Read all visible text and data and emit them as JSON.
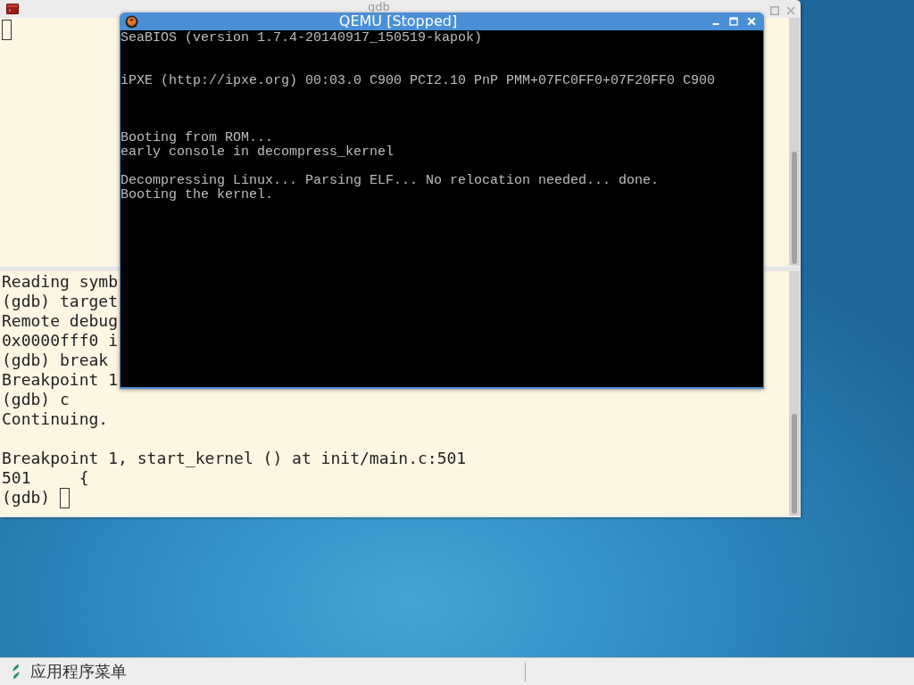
{
  "gdb_window": {
    "title": "gdb",
    "upper_pane": {
      "cursor": true
    },
    "lower_pane": {
      "groups": [
        {
          "lines": [
            "Reading symb",
            "(gdb) target",
            "Remote debug",
            "0x0000fff0 i",
            "(gdb) break",
            "Breakpoint 1",
            "(gdb) c",
            "Continuing."
          ]
        },
        {
          "lines": [
            "Breakpoint 1, start_kernel () at init/main.c:501",
            "501     {",
            "(gdb)"
          ]
        }
      ],
      "cursor": true
    }
  },
  "qemu_window": {
    "title": "QEMU [Stopped]",
    "screen_blocks": [
      {
        "lines": [
          "SeaBIOS (version 1.7.4-20140917_150519-kapok)"
        ]
      },
      {
        "lines": [
          "iPXE (http://ipxe.org) 00:03.0 C900 PCI2.10 PnP PMM+07FC0FF0+07F20FF0 C900"
        ]
      },
      {
        "lines": [
          "Booting from ROM...",
          "early console in decompress_kernel"
        ]
      },
      {
        "lines": [
          "Decompressing Linux... Parsing ELF... No relocation needed... done.",
          "Booting the kernel."
        ]
      }
    ]
  },
  "taskbar": {
    "menu_label": "应用程序菜单"
  }
}
